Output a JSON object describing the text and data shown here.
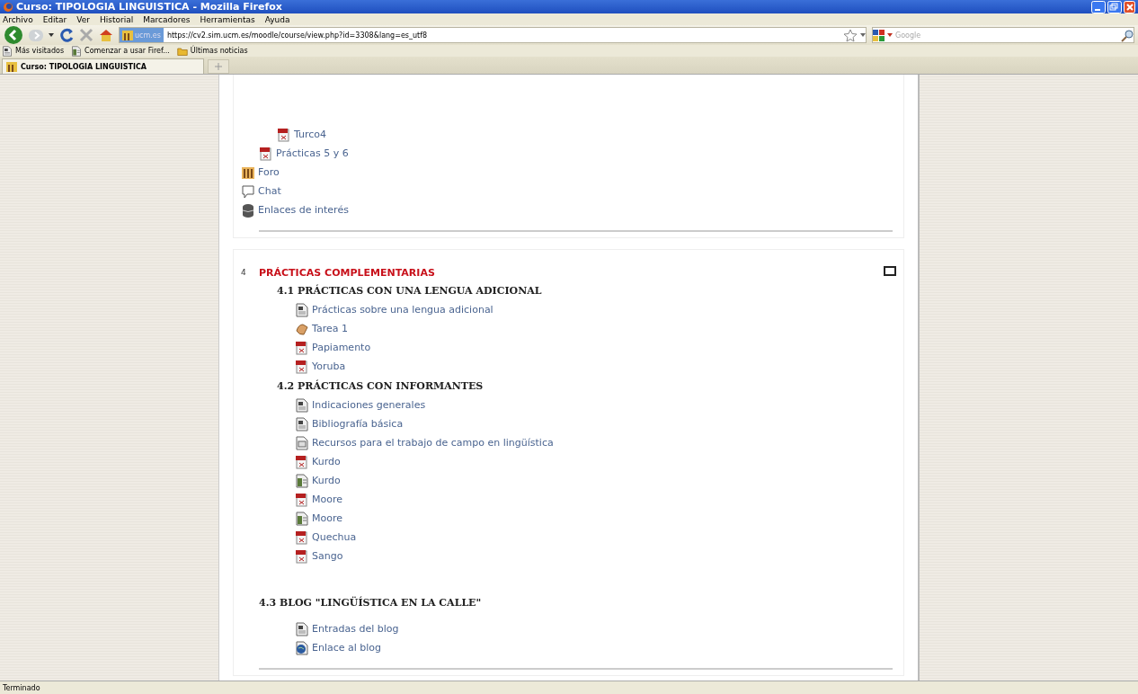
{
  "window": {
    "title": "Curso: TIPOLOGIA LINGUISTICA - Mozilla Firefox"
  },
  "menu": [
    "Archivo",
    "Editar",
    "Ver",
    "Historial",
    "Marcadores",
    "Herramientas",
    "Ayuda"
  ],
  "navigation": {
    "site_badge": "ucm.es",
    "url": "https://cv2.sim.ucm.es/moodle/course/view.php?id=3308&lang=es_utf8",
    "search_placeholder": "Google"
  },
  "bookmarks": [
    {
      "label": "Más visitados",
      "kind": "page"
    },
    {
      "label": "Comenzar a usar Firef...",
      "kind": "doc"
    },
    {
      "label": "Últimas noticias",
      "kind": "folder"
    }
  ],
  "tabs": [
    {
      "label": "Curso: TIPOLOGIA LINGUISTICA",
      "selected": true
    }
  ],
  "sections": [
    {
      "items": [
        {
          "kind": "group",
          "children": [
            {
              "kind": "group",
              "children": [
                {
                  "kind": "pdf",
                  "label": "Turco4"
                }
              ]
            },
            {
              "kind": "pdf",
              "label": "Prácticas 5 y 6"
            }
          ]
        },
        {
          "kind": "forum",
          "label": "Foro"
        },
        {
          "kind": "chat",
          "label": "Chat"
        },
        {
          "kind": "database",
          "label": "Enlaces de interés"
        }
      ]
    },
    {
      "number": "4",
      "title": "PRÁCTICAS COMPLEMENTARIAS",
      "subsections": [
        {
          "title": "4.1 PRÁCTICAS CON UNA LENGUA ADICIONAL",
          "items": [
            {
              "kind": "page",
              "label": "Prácticas sobre una lengua adicional"
            },
            {
              "kind": "assignment",
              "label": "Tarea 1"
            },
            {
              "kind": "pdf",
              "label": "Papiamento"
            },
            {
              "kind": "pdf",
              "label": "Yoruba"
            }
          ]
        },
        {
          "title": "4.2 PRÁCTICAS CON INFORMANTES",
          "items": [
            {
              "kind": "page",
              "label": "Indicaciones generales"
            },
            {
              "kind": "page",
              "label": "Bibliografía básica"
            },
            {
              "kind": "html",
              "label": "Recursos para el trabajo de campo en lingüística"
            },
            {
              "kind": "pdf",
              "label": "Kurdo"
            },
            {
              "kind": "doc",
              "label": "Kurdo"
            },
            {
              "kind": "pdf",
              "label": "Moore"
            },
            {
              "kind": "doc",
              "label": "Moore"
            },
            {
              "kind": "pdf",
              "label": "Quechua"
            },
            {
              "kind": "pdf",
              "label": "Sango"
            }
          ]
        },
        {
          "title": "4.3 BLOG \"LINGÜÍSTICA EN LA CALLE\"",
          "spaced": true,
          "items": [
            {
              "kind": "page",
              "label": "Entradas del blog"
            },
            {
              "kind": "link",
              "label": "Enlace al blog"
            }
          ]
        }
      ]
    }
  ],
  "status_bar": "Terminado"
}
